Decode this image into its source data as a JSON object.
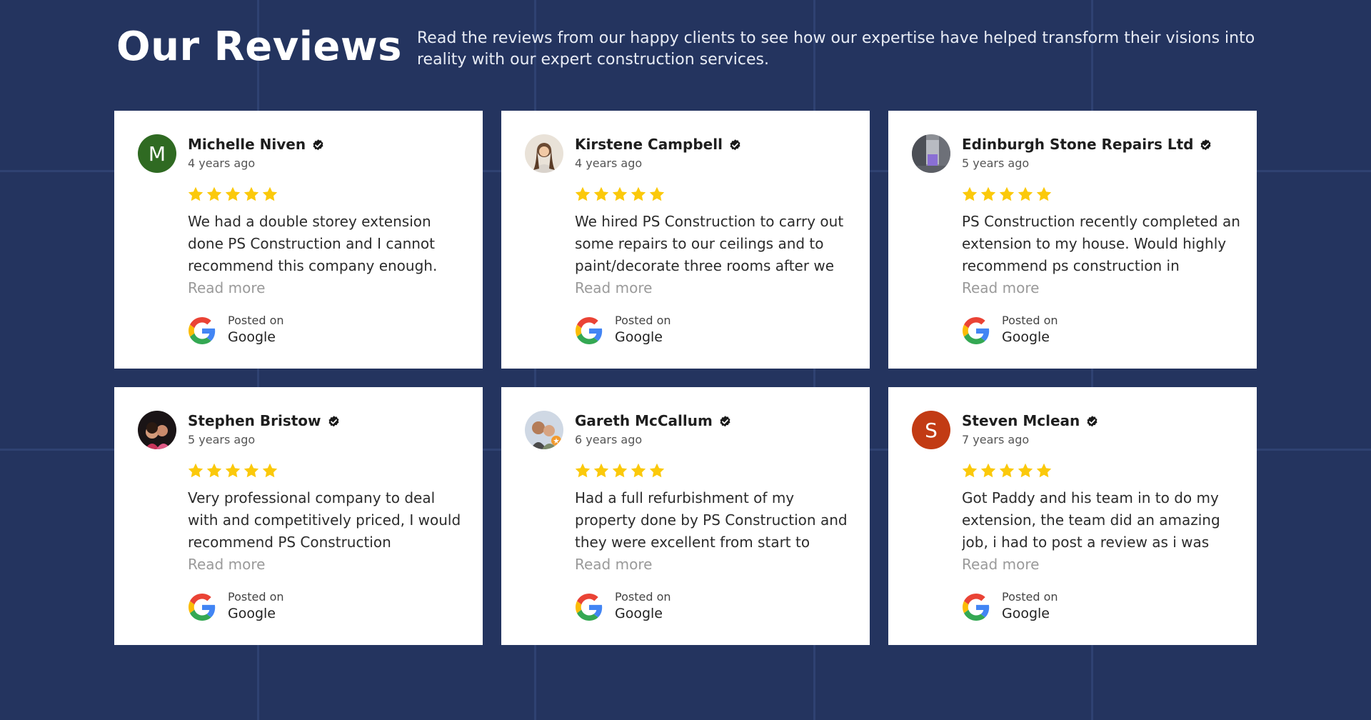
{
  "header": {
    "title": "Our Reviews",
    "intro": "Read the reviews from our happy clients to see how our expertise have helped transform their visions into reality with our expert construction services."
  },
  "colors": {
    "background": "#24345f",
    "star": "#fbc90b",
    "card": "#ffffff",
    "read_more": "#9a9a9a"
  },
  "icons": {
    "verified": "verified-badge-icon",
    "star": "star-icon",
    "platform": "google-logo-icon"
  },
  "reviews": [
    {
      "name": "Michelle Niven",
      "date": "4 years ago",
      "avatar_letter": "M",
      "avatar_color": "#2f6a22",
      "avatar_type": "letter",
      "rating": 5,
      "text": "We had a double storey extension done PS Construction and I cannot recommend this company enough.",
      "read_more": "Read more",
      "posted_on": "Posted on",
      "platform": "Google"
    },
    {
      "name": "Kirstene Campbell",
      "date": "4 years ago",
      "avatar_type": "photo",
      "rating": 5,
      "text": "We hired PS Construction to carry out some repairs to our ceilings and to paint/decorate three rooms after we",
      "read_more": "Read more",
      "posted_on": "Posted on",
      "platform": "Google"
    },
    {
      "name": "Edinburgh Stone Repairs Ltd",
      "date": "5 years ago",
      "avatar_type": "photo",
      "rating": 5,
      "text": "PS Construction recently completed an extension to my house. Would highly recommend ps construction in",
      "read_more": "Read more",
      "posted_on": "Posted on",
      "platform": "Google"
    },
    {
      "name": "Stephen Bristow",
      "date": "5 years ago",
      "avatar_type": "photo",
      "rating": 5,
      "text": "Very professional company to deal with and competitively priced, I would recommend PS Construction",
      "read_more": "Read more",
      "posted_on": "Posted on",
      "platform": "Google"
    },
    {
      "name": "Gareth McCallum",
      "date": "6 years ago",
      "avatar_type": "photo",
      "rating": 5,
      "text": "Had a full refurbishment of my property done by PS Construction and they were excellent from start to",
      "read_more": "Read more",
      "posted_on": "Posted on",
      "platform": "Google"
    },
    {
      "name": "Steven Mclean",
      "date": "7 years ago",
      "avatar_letter": "S",
      "avatar_color": "#c23b14",
      "avatar_type": "letter",
      "rating": 5,
      "text": "Got Paddy and his team in to do my extension, the team did an amazing job, i had to post a review as i was",
      "read_more": "Read more",
      "posted_on": "Posted on",
      "platform": "Google"
    }
  ]
}
